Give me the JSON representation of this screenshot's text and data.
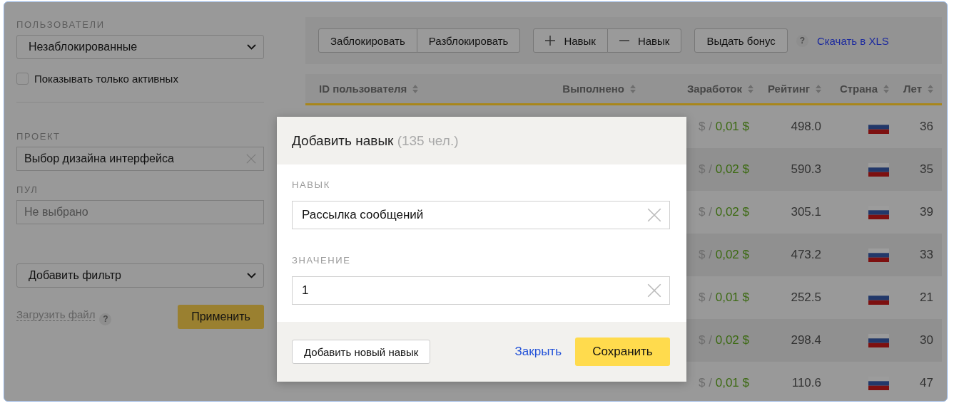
{
  "filters": {
    "users_label": "ПОЛЬЗОВАТЕЛИ",
    "users_select": "Незаблокированные",
    "active_only": {
      "label": "Показывать только активных",
      "checked": false
    },
    "project_label": "ПРОЕКТ",
    "project_value": "Выбор дизайна интерфейса",
    "pool_label": "ПУЛ",
    "pool_placeholder": "Не выбрано",
    "add_filter": "Добавить фильтр",
    "upload_link": "Загрузить файл",
    "upload_help": "?",
    "apply_button": "Применить"
  },
  "toolbar": {
    "groups": [
      [
        {
          "label": "Заблокировать"
        },
        {
          "label": "Разблокировать"
        }
      ],
      [
        {
          "label": "Навык",
          "kind": "plus"
        },
        {
          "label": "Навык",
          "kind": "minus"
        }
      ],
      [
        {
          "label": "Выдать бонус"
        }
      ]
    ],
    "help": "?",
    "download_link": "Скачать в XLS"
  },
  "table": {
    "columns": [
      {
        "label": "ID пользователя"
      },
      {
        "label": "Выполнено"
      },
      {
        "label": "Заработок"
      },
      {
        "label": "Рейтинг"
      },
      {
        "label": "Страна"
      },
      {
        "label": "Лет"
      }
    ],
    "rows": [
      {
        "earned_paid": "$ /",
        "earned_total": "0,01 $",
        "rating": "498.0",
        "age": "36"
      },
      {
        "earned_paid": "$ /",
        "earned_total": "0,02 $",
        "rating": "590.3",
        "age": "35"
      },
      {
        "earned_paid": "$ /",
        "earned_total": "0,02 $",
        "rating": "305.1",
        "age": "39"
      },
      {
        "earned_paid": "$ /",
        "earned_total": "0,02 $",
        "rating": "473.2",
        "age": "33"
      },
      {
        "earned_paid": "$ /",
        "earned_total": "0,01 $",
        "rating": "252.5",
        "age": "21"
      },
      {
        "earned_paid": "$ /",
        "earned_total": "0,02 $",
        "rating": "298.4",
        "age": "30"
      },
      {
        "earned_paid": "$ /",
        "earned_total": "0,01 $",
        "rating": "110.6",
        "age": "47"
      }
    ]
  },
  "dialog": {
    "title": "Добавить навык",
    "count": "(135 чел.)",
    "fields": [
      {
        "label": "НАВЫК",
        "value": "Рассылка сообщений"
      },
      {
        "label": "ЗНАЧЕНИЕ",
        "value": "1"
      }
    ],
    "add_button": "Добавить новый навык",
    "close_link": "Закрыть",
    "save_button": "Сохранить"
  }
}
